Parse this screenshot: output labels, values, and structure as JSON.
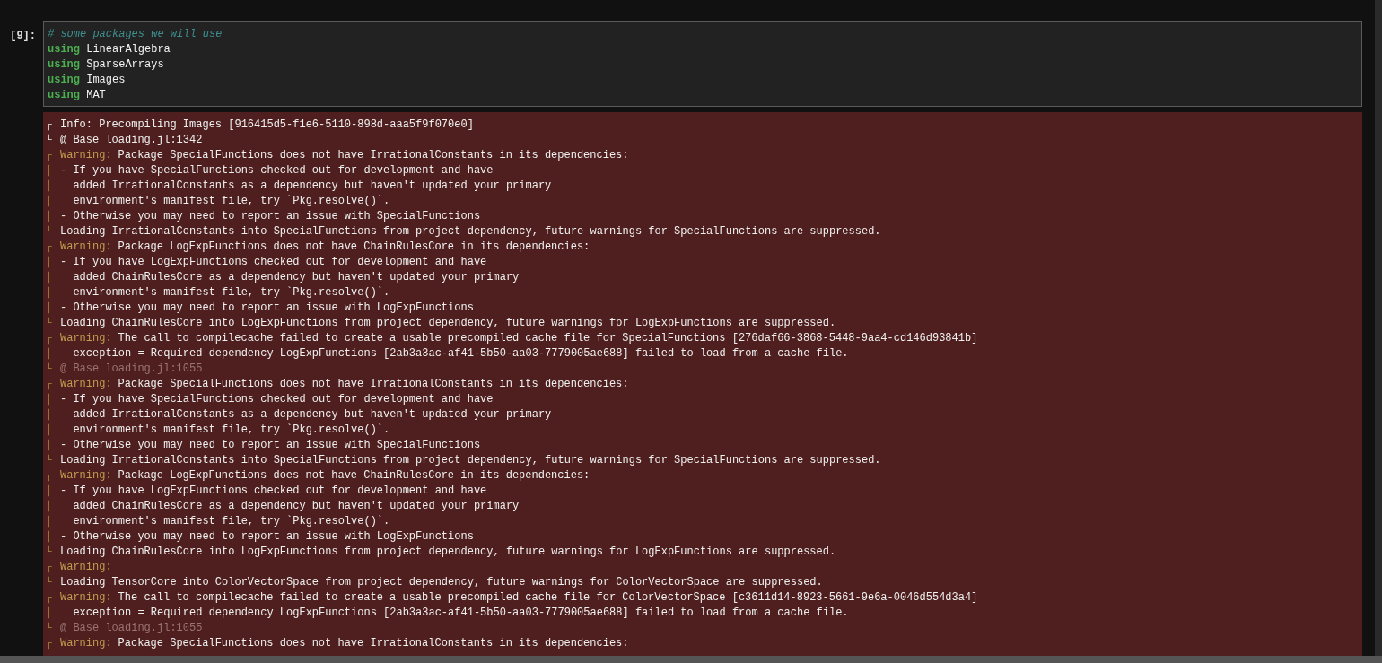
{
  "input_cell": {
    "prompt": "[9]:",
    "lines": [
      {
        "kind": "comment",
        "text": "# some packages we will use"
      },
      {
        "kind": "using",
        "keyword": "using",
        "text": "LinearAlgebra"
      },
      {
        "kind": "using",
        "keyword": "using",
        "text": "SparseArrays"
      },
      {
        "kind": "using",
        "keyword": "using",
        "text": "Images"
      },
      {
        "kind": "using",
        "keyword": "using",
        "text": "MAT"
      }
    ]
  },
  "output": {
    "lines": [
      {
        "kind": "info",
        "bracket": "┌",
        "text": "Info: Precompiling Images [916415d5-f1e6-5110-898d-aaa5f9f070e0]"
      },
      {
        "kind": "info",
        "bracket": "└",
        "text": "@ Base loading.jl:1342"
      },
      {
        "kind": "warn",
        "bracket": "┌",
        "label": "Warning:",
        "text": "Package SpecialFunctions does not have IrrationalConstants in its dependencies:"
      },
      {
        "kind": "warn",
        "bracket": "│",
        "text": "- If you have SpecialFunctions checked out for development and have"
      },
      {
        "kind": "warn",
        "bracket": "│",
        "text": "  added IrrationalConstants as a dependency but haven't updated your primary"
      },
      {
        "kind": "warn",
        "bracket": "│",
        "text": "  environment's manifest file, try `Pkg.resolve()`."
      },
      {
        "kind": "warn",
        "bracket": "│",
        "text": "- Otherwise you may need to report an issue with SpecialFunctions"
      },
      {
        "kind": "warn",
        "bracket": "└",
        "text": "Loading IrrationalConstants into SpecialFunctions from project dependency, future warnings for SpecialFunctions are suppressed."
      },
      {
        "kind": "warn",
        "bracket": "┌",
        "label": "Warning:",
        "text": "Package LogExpFunctions does not have ChainRulesCore in its dependencies:"
      },
      {
        "kind": "warn",
        "bracket": "│",
        "text": "- If you have LogExpFunctions checked out for development and have"
      },
      {
        "kind": "warn",
        "bracket": "│",
        "text": "  added ChainRulesCore as a dependency but haven't updated your primary"
      },
      {
        "kind": "warn",
        "bracket": "│",
        "text": "  environment's manifest file, try `Pkg.resolve()`."
      },
      {
        "kind": "warn",
        "bracket": "│",
        "text": "- Otherwise you may need to report an issue with LogExpFunctions"
      },
      {
        "kind": "warn",
        "bracket": "└",
        "text": "Loading ChainRulesCore into LogExpFunctions from project dependency, future warnings for LogExpFunctions are suppressed."
      },
      {
        "kind": "warn",
        "bracket": "┌",
        "label": "Warning:",
        "text": "The call to compilecache failed to create a usable precompiled cache file for SpecialFunctions [276daf66-3868-5448-9aa4-cd146d93841b]"
      },
      {
        "kind": "warn",
        "bracket": "│",
        "text": "  exception = Required dependency LogExpFunctions [2ab3a3ac-af41-5b50-aa03-7779005ae688] failed to load from a cache file."
      },
      {
        "kind": "dim",
        "bracket": "└",
        "text": "@ Base loading.jl:1055"
      },
      {
        "kind": "warn",
        "bracket": "┌",
        "label": "Warning:",
        "text": "Package SpecialFunctions does not have IrrationalConstants in its dependencies:"
      },
      {
        "kind": "warn",
        "bracket": "│",
        "text": "- If you have SpecialFunctions checked out for development and have"
      },
      {
        "kind": "warn",
        "bracket": "│",
        "text": "  added IrrationalConstants as a dependency but haven't updated your primary"
      },
      {
        "kind": "warn",
        "bracket": "│",
        "text": "  environment's manifest file, try `Pkg.resolve()`."
      },
      {
        "kind": "warn",
        "bracket": "│",
        "text": "- Otherwise you may need to report an issue with SpecialFunctions"
      },
      {
        "kind": "warn",
        "bracket": "└",
        "text": "Loading IrrationalConstants into SpecialFunctions from project dependency, future warnings for SpecialFunctions are suppressed."
      },
      {
        "kind": "warn",
        "bracket": "┌",
        "label": "Warning:",
        "text": "Package LogExpFunctions does not have ChainRulesCore in its dependencies:"
      },
      {
        "kind": "warn",
        "bracket": "│",
        "text": "- If you have LogExpFunctions checked out for development and have"
      },
      {
        "kind": "warn",
        "bracket": "│",
        "text": "  added ChainRulesCore as a dependency but haven't updated your primary"
      },
      {
        "kind": "warn",
        "bracket": "│",
        "text": "  environment's manifest file, try `Pkg.resolve()`."
      },
      {
        "kind": "warn",
        "bracket": "│",
        "text": "- Otherwise you may need to report an issue with LogExpFunctions"
      },
      {
        "kind": "warn",
        "bracket": "└",
        "text": "Loading ChainRulesCore into LogExpFunctions from project dependency, future warnings for LogExpFunctions are suppressed."
      },
      {
        "kind": "warn",
        "bracket": "┌",
        "label": "Warning:"
      },
      {
        "kind": "warn",
        "bracket": "└",
        "text": "Loading TensorCore into ColorVectorSpace from project dependency, future warnings for ColorVectorSpace are suppressed."
      },
      {
        "kind": "warn",
        "bracket": "┌",
        "label": "Warning:",
        "text": "The call to compilecache failed to create a usable precompiled cache file for ColorVectorSpace [c3611d14-8923-5661-9e6a-0046d554d3a4]"
      },
      {
        "kind": "warn",
        "bracket": "│",
        "text": "  exception = Required dependency LogExpFunctions [2ab3a3ac-af41-5b50-aa03-7779005ae688] failed to load from a cache file."
      },
      {
        "kind": "dim",
        "bracket": "└",
        "text": "@ Base loading.jl:1055"
      },
      {
        "kind": "warn",
        "bracket": "┌",
        "label": "Warning:",
        "text": "Package SpecialFunctions does not have IrrationalConstants in its dependencies:"
      }
    ]
  }
}
